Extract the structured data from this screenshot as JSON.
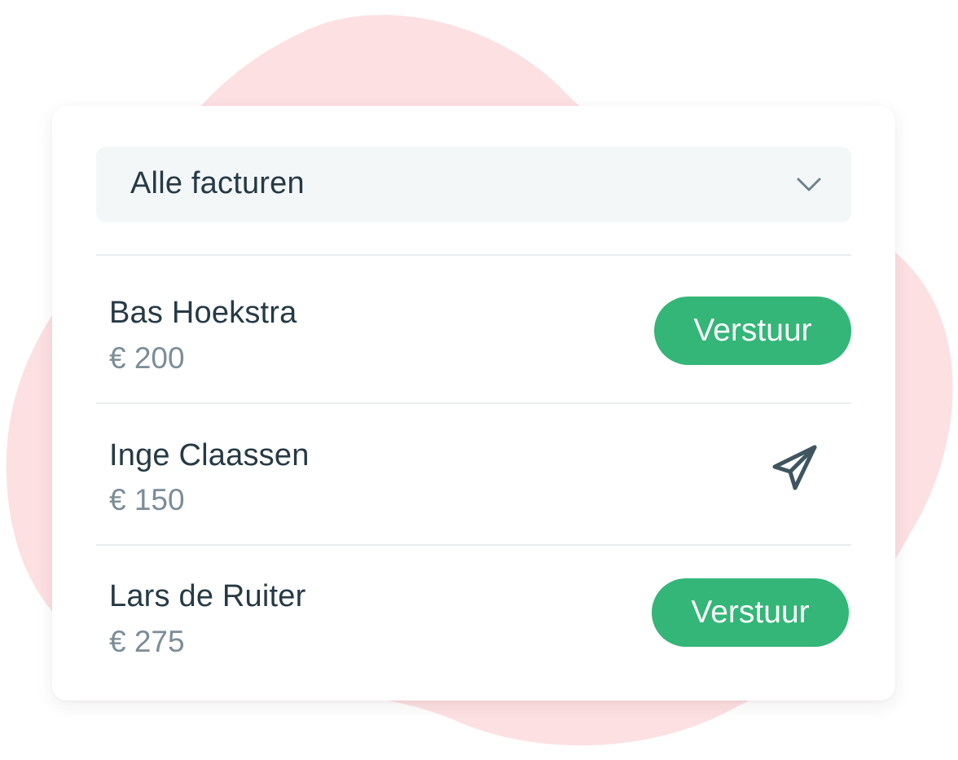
{
  "filter": {
    "selected_label": "Alle facturen",
    "icon": "chevron-down-icon"
  },
  "invoices": [
    {
      "name": "Bas Hoekstra",
      "amount": "€ 200",
      "action": "button",
      "action_label": "Verstuur"
    },
    {
      "name": "Inge Claassen",
      "amount": "€ 150",
      "action": "icon",
      "action_icon": "paper-plane-icon"
    },
    {
      "name": "Lars de Ruiter",
      "amount": "€ 275",
      "action": "button",
      "action_label": "Verstuur"
    }
  ],
  "colors": {
    "accent_green": "#33b677",
    "background_blob": "#fde0e2",
    "text_primary": "#263a45",
    "text_secondary": "#7b8d97"
  }
}
